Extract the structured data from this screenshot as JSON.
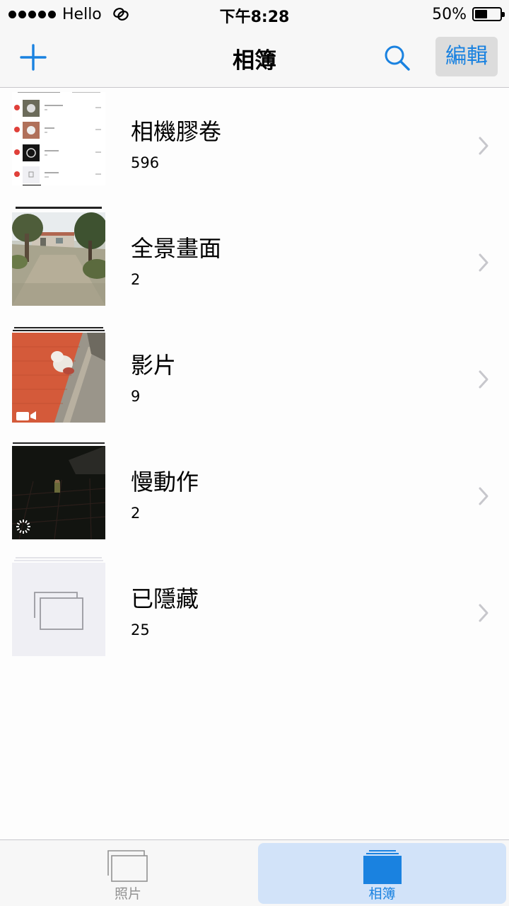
{
  "status_bar": {
    "carrier": "Hello",
    "time": "下午8:28",
    "battery_percent_label": "50%",
    "battery_level": 0.5
  },
  "nav": {
    "title": "相簿",
    "edit_label": "編輯",
    "add_icon": "plus-icon",
    "search_icon": "search-icon"
  },
  "albums": [
    {
      "name": "相機膠卷",
      "count": "596",
      "thumbnail": "camera-roll-screenshot"
    },
    {
      "name": "全景畫面",
      "count": "2",
      "thumbnail": "panorama-courtyard"
    },
    {
      "name": "影片",
      "count": "9",
      "thumbnail": "video-dog-on-ledge",
      "badge_icon": "video-camera-icon"
    },
    {
      "name": "慢動作",
      "count": "2",
      "thumbnail": "slowmo-dark-scene",
      "badge_icon": "slow-motion-icon"
    },
    {
      "name": "已隱藏",
      "count": "25",
      "thumbnail": "hidden-placeholder"
    }
  ],
  "tabs": [
    {
      "label": "照片",
      "selected": false
    },
    {
      "label": "相簿",
      "selected": true
    }
  ],
  "colors": {
    "accent": "#1a82e0",
    "bar_background": "#f7f7f7",
    "selected_tab_background": "#d2e3f9",
    "chevron": "#c7c7cc"
  }
}
